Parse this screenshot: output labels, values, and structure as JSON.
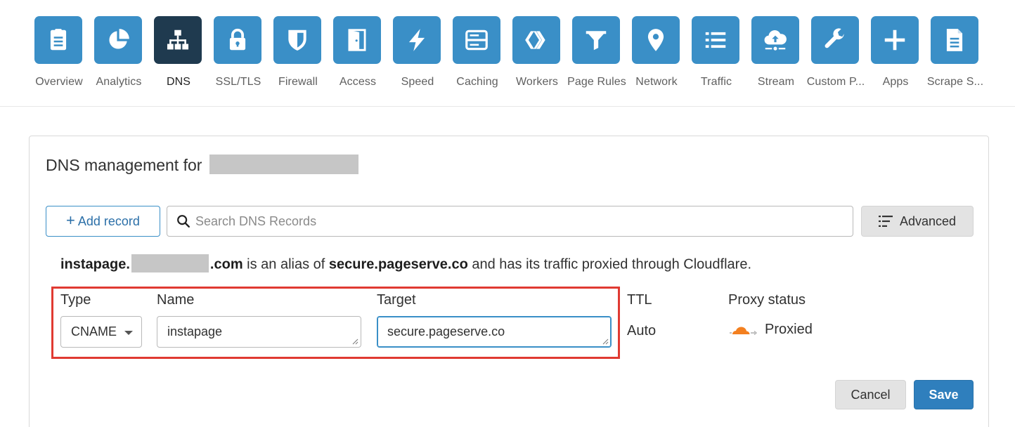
{
  "nav": {
    "active": "DNS",
    "items": [
      {
        "label": "Overview",
        "icon": "clipboard-icon"
      },
      {
        "label": "Analytics",
        "icon": "pie-chart-icon"
      },
      {
        "label": "DNS",
        "icon": "network-tree-icon"
      },
      {
        "label": "SSL/TLS",
        "icon": "lock-icon"
      },
      {
        "label": "Firewall",
        "icon": "shield-icon"
      },
      {
        "label": "Access",
        "icon": "door-icon"
      },
      {
        "label": "Speed",
        "icon": "lightning-icon"
      },
      {
        "label": "Caching",
        "icon": "server-icon"
      },
      {
        "label": "Workers",
        "icon": "workers-icon"
      },
      {
        "label": "Page Rules",
        "icon": "filter-icon"
      },
      {
        "label": "Network",
        "icon": "location-pin-icon"
      },
      {
        "label": "Traffic",
        "icon": "list-icon"
      },
      {
        "label": "Stream",
        "icon": "cloud-upload-icon"
      },
      {
        "label": "Custom P...",
        "icon": "wrench-icon"
      },
      {
        "label": "Apps",
        "icon": "plus-icon"
      },
      {
        "label": "Scrape S...",
        "icon": "document-icon"
      }
    ]
  },
  "card": {
    "title": "DNS management for"
  },
  "toolbar": {
    "add_label": "Add record",
    "search_placeholder": "Search DNS Records",
    "advanced_label": "Advanced"
  },
  "alias": {
    "prefix": "instapage.",
    "suffix": ".com",
    "middle": " is an alias of ",
    "target": "secure.pageserve.co",
    "tail": " and has its traffic proxied through Cloudflare."
  },
  "record": {
    "type_label": "Type",
    "name_label": "Name",
    "target_label": "Target",
    "ttl_label": "TTL",
    "proxy_label": "Proxy status",
    "type_value": "CNAME",
    "name_value": "instapage",
    "target_value": "secure.pageserve.co",
    "ttl_value": "Auto",
    "proxy_value": "Proxied"
  },
  "actions": {
    "cancel_label": "Cancel",
    "save_label": "Save"
  },
  "colors": {
    "tile": "#3a8fc7",
    "tile_active": "#1f3a4f",
    "highlight": "#e03a32",
    "proxy_cloud": "#f38020",
    "save": "#2f7fbd"
  }
}
